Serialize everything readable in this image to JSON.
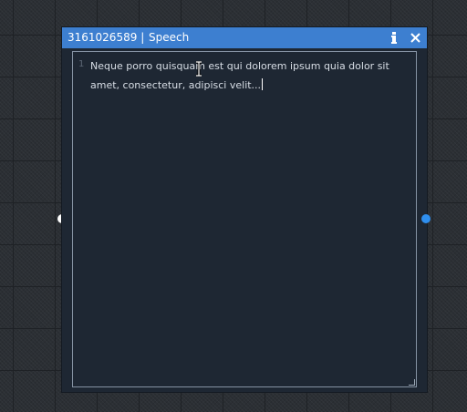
{
  "node": {
    "id": "3161026589",
    "separator": "|",
    "type": "Speech",
    "info_icon": "info-icon",
    "close_icon": "close-icon",
    "title_bar_color": "#3d7fd0",
    "body_color": "#1e2733"
  },
  "editor": {
    "line_number": "1",
    "text": "Neque porro quisquam est qui dolorem ipsum quia dolor sit amet, consectetur, adipisci velit..."
  },
  "ports": {
    "input_color": "#ffffff",
    "output_color": "#2f8fef"
  }
}
